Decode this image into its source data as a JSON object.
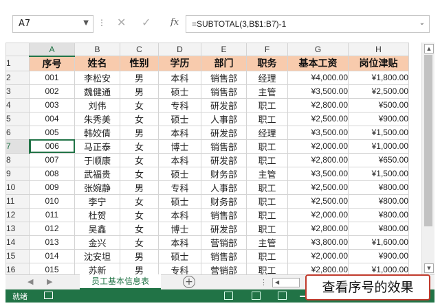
{
  "formula_bar": {
    "name_box": "A7",
    "fx_label": "fx",
    "formula": "=SUBTOTAL(3,B$1:B7)-1"
  },
  "columns": [
    "A",
    "B",
    "C",
    "D",
    "E",
    "F",
    "G",
    "H"
  ],
  "active_cell": {
    "row": 7,
    "col": "A"
  },
  "header_row": [
    "序号",
    "姓名",
    "性别",
    "学历",
    "部门",
    "职务",
    "基本工资",
    "岗位津贴"
  ],
  "rows": [
    [
      "001",
      "李松安",
      "男",
      "本科",
      "销售部",
      "经理",
      "¥4,000.00",
      "¥1,800.00"
    ],
    [
      "002",
      "魏健通",
      "男",
      "硕士",
      "销售部",
      "主管",
      "¥3,500.00",
      "¥2,500.00"
    ],
    [
      "003",
      "刘伟",
      "女",
      "专科",
      "研发部",
      "职工",
      "¥2,800.00",
      "¥500.00"
    ],
    [
      "004",
      "朱秀美",
      "女",
      "硕士",
      "人事部",
      "职工",
      "¥2,500.00",
      "¥900.00"
    ],
    [
      "005",
      "韩姣倩",
      "男",
      "本科",
      "研发部",
      "经理",
      "¥3,500.00",
      "¥1,500.00"
    ],
    [
      "006",
      "马正泰",
      "女",
      "博士",
      "销售部",
      "职工",
      "¥2,000.00",
      "¥1,000.00"
    ],
    [
      "007",
      "于顺康",
      "女",
      "本科",
      "研发部",
      "职工",
      "¥2,800.00",
      "¥650.00"
    ],
    [
      "008",
      "武福贵",
      "女",
      "硕士",
      "财务部",
      "主管",
      "¥3,500.00",
      "¥1,500.00"
    ],
    [
      "009",
      "张婉静",
      "男",
      "专科",
      "人事部",
      "职工",
      "¥2,500.00",
      "¥800.00"
    ],
    [
      "010",
      "李宁",
      "女",
      "硕士",
      "财务部",
      "职工",
      "¥2,500.00",
      "¥800.00"
    ],
    [
      "011",
      "杜贺",
      "女",
      "本科",
      "销售部",
      "职工",
      "¥2,000.00",
      "¥800.00"
    ],
    [
      "012",
      "吴鑫",
      "女",
      "博士",
      "研发部",
      "职工",
      "¥2,800.00",
      "¥800.00"
    ],
    [
      "013",
      "金兴",
      "女",
      "本科",
      "营销部",
      "主管",
      "¥3,800.00",
      "¥1,600.00"
    ],
    [
      "014",
      "沈安坦",
      "男",
      "硕士",
      "销售部",
      "职工",
      "¥2,000.00",
      "¥900.00"
    ],
    [
      "015",
      "苏新",
      "男",
      "专科",
      "营销部",
      "职工",
      "¥2,800.00",
      "¥1,000.00"
    ]
  ],
  "sheet_tab": "员工基本信息表",
  "status": {
    "ready": "就绪"
  },
  "callout": "查看序号的效果",
  "colors": {
    "header_fill": "#f8cbad",
    "excel_green": "#217346",
    "callout_border": "#c0392b"
  }
}
